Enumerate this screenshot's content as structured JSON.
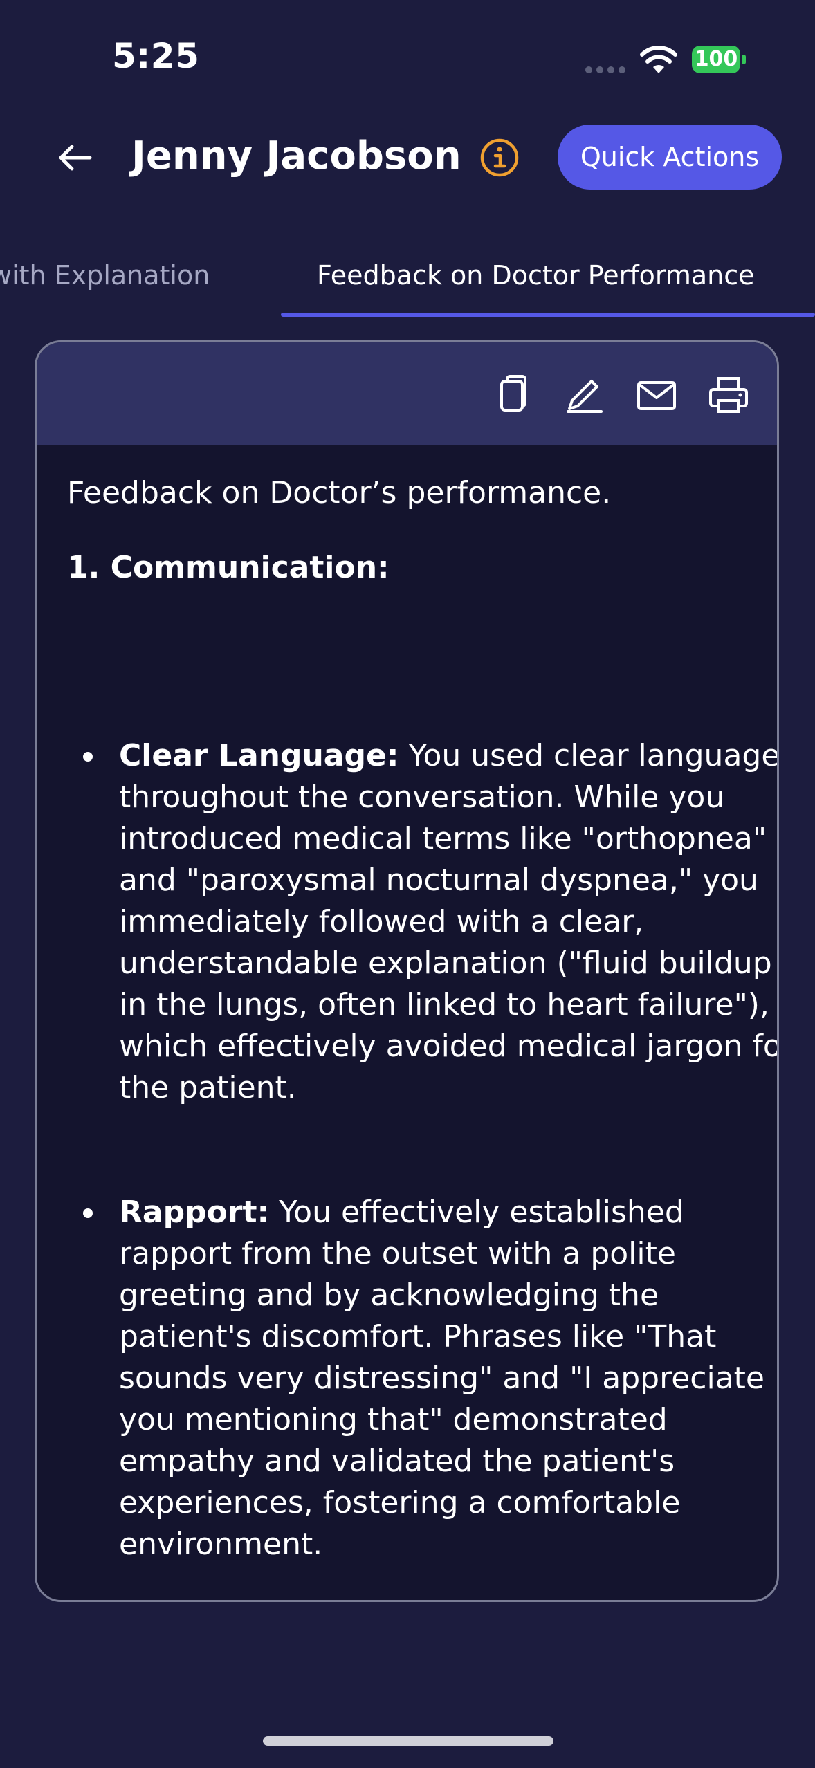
{
  "status_bar": {
    "time": "5:25",
    "battery": "100",
    "colors": {
      "battery": "#34c759"
    }
  },
  "header": {
    "title": "Jenny Jacobson",
    "back_icon": "arrow-left-icon",
    "info_icon": "info-circle-icon",
    "quick_actions_label": "Quick Actions",
    "colors": {
      "accent": "#5558e6",
      "info": "#f0a030"
    }
  },
  "tabs": [
    {
      "label": "with Explanation",
      "active": false
    },
    {
      "label": "Feedback on Doctor Performance",
      "active": true
    }
  ],
  "card": {
    "toolbar_icons": [
      "copy-icon",
      "edit-pencil-icon",
      "mail-icon",
      "print-icon"
    ],
    "intro": "Feedback on Doctor’s performance.",
    "section_heading": "1. Communication:",
    "bullets": [
      {
        "term": "Clear Language:",
        "text": " You used clear language throughout the conversation. While you introduced medical terms like \"orthopnea\" and \"paroxysmal nocturnal dyspnea,\" you immediately followed with a clear, understandable explanation (\"fluid buildup in the lungs, often linked to heart failure\"), which effectively avoided medical jargon for the patient."
      },
      {
        "term": "Rapport:",
        "text": " You effectively established rapport from the outset with a polite greeting and by acknowledging the patient's discomfort. Phrases like \"That sounds very distressing\" and \"I appreciate you mentioning that\" demonstrated empathy and validated the patient's experiences, fostering a comfortable environment."
      }
    ]
  }
}
